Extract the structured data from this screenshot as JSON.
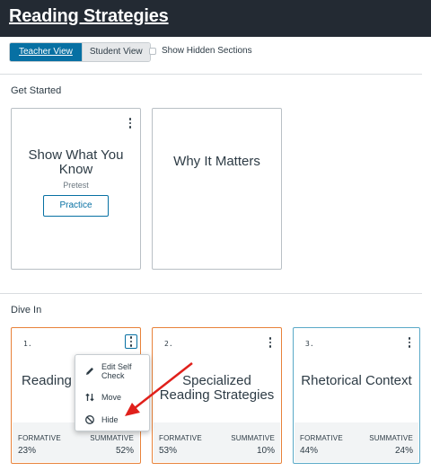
{
  "app": {
    "title": "Reading Strategies"
  },
  "toolbar": {
    "teacher_view": "Teacher View",
    "student_view": "Student View",
    "show_hidden_label": "Show Hidden Sections",
    "show_hidden_checked": false
  },
  "sections": {
    "get_started": {
      "heading": "Get Started",
      "cards": [
        {
          "title": "Show What You Know",
          "subtitle": "Pretest",
          "button": "Practice"
        },
        {
          "title": "Why It Matters"
        }
      ]
    },
    "dive_in": {
      "heading": "Dive In",
      "cards": [
        {
          "number": "1.",
          "title": "Reading S",
          "formative_label": "FORMATIVE",
          "summative_label": "SUMMATIVE",
          "formative": "23%",
          "summative": "52%",
          "accent": "#e8823a"
        },
        {
          "number": "2.",
          "title": "Specialized Reading Strategies",
          "formative_label": "FORMATIVE",
          "summative_label": "SUMMATIVE",
          "formative": "53%",
          "summative": "10%",
          "accent": "#e8823a"
        },
        {
          "number": "3.",
          "title": "Rhetorical Context",
          "formative_label": "FORMATIVE",
          "summative_label": "SUMMATIVE",
          "formative": "44%",
          "summative": "24%",
          "accent": "#5aa9c7"
        }
      ]
    }
  },
  "context_menu": {
    "items": [
      {
        "label": "Edit Self Check",
        "icon": "pencil-icon"
      },
      {
        "label": "Move",
        "icon": "move-arrows-icon"
      },
      {
        "label": "Hide",
        "icon": "hide-icon"
      }
    ]
  },
  "annotation_color": "#e0201b",
  "accent_color": "#0770a3"
}
